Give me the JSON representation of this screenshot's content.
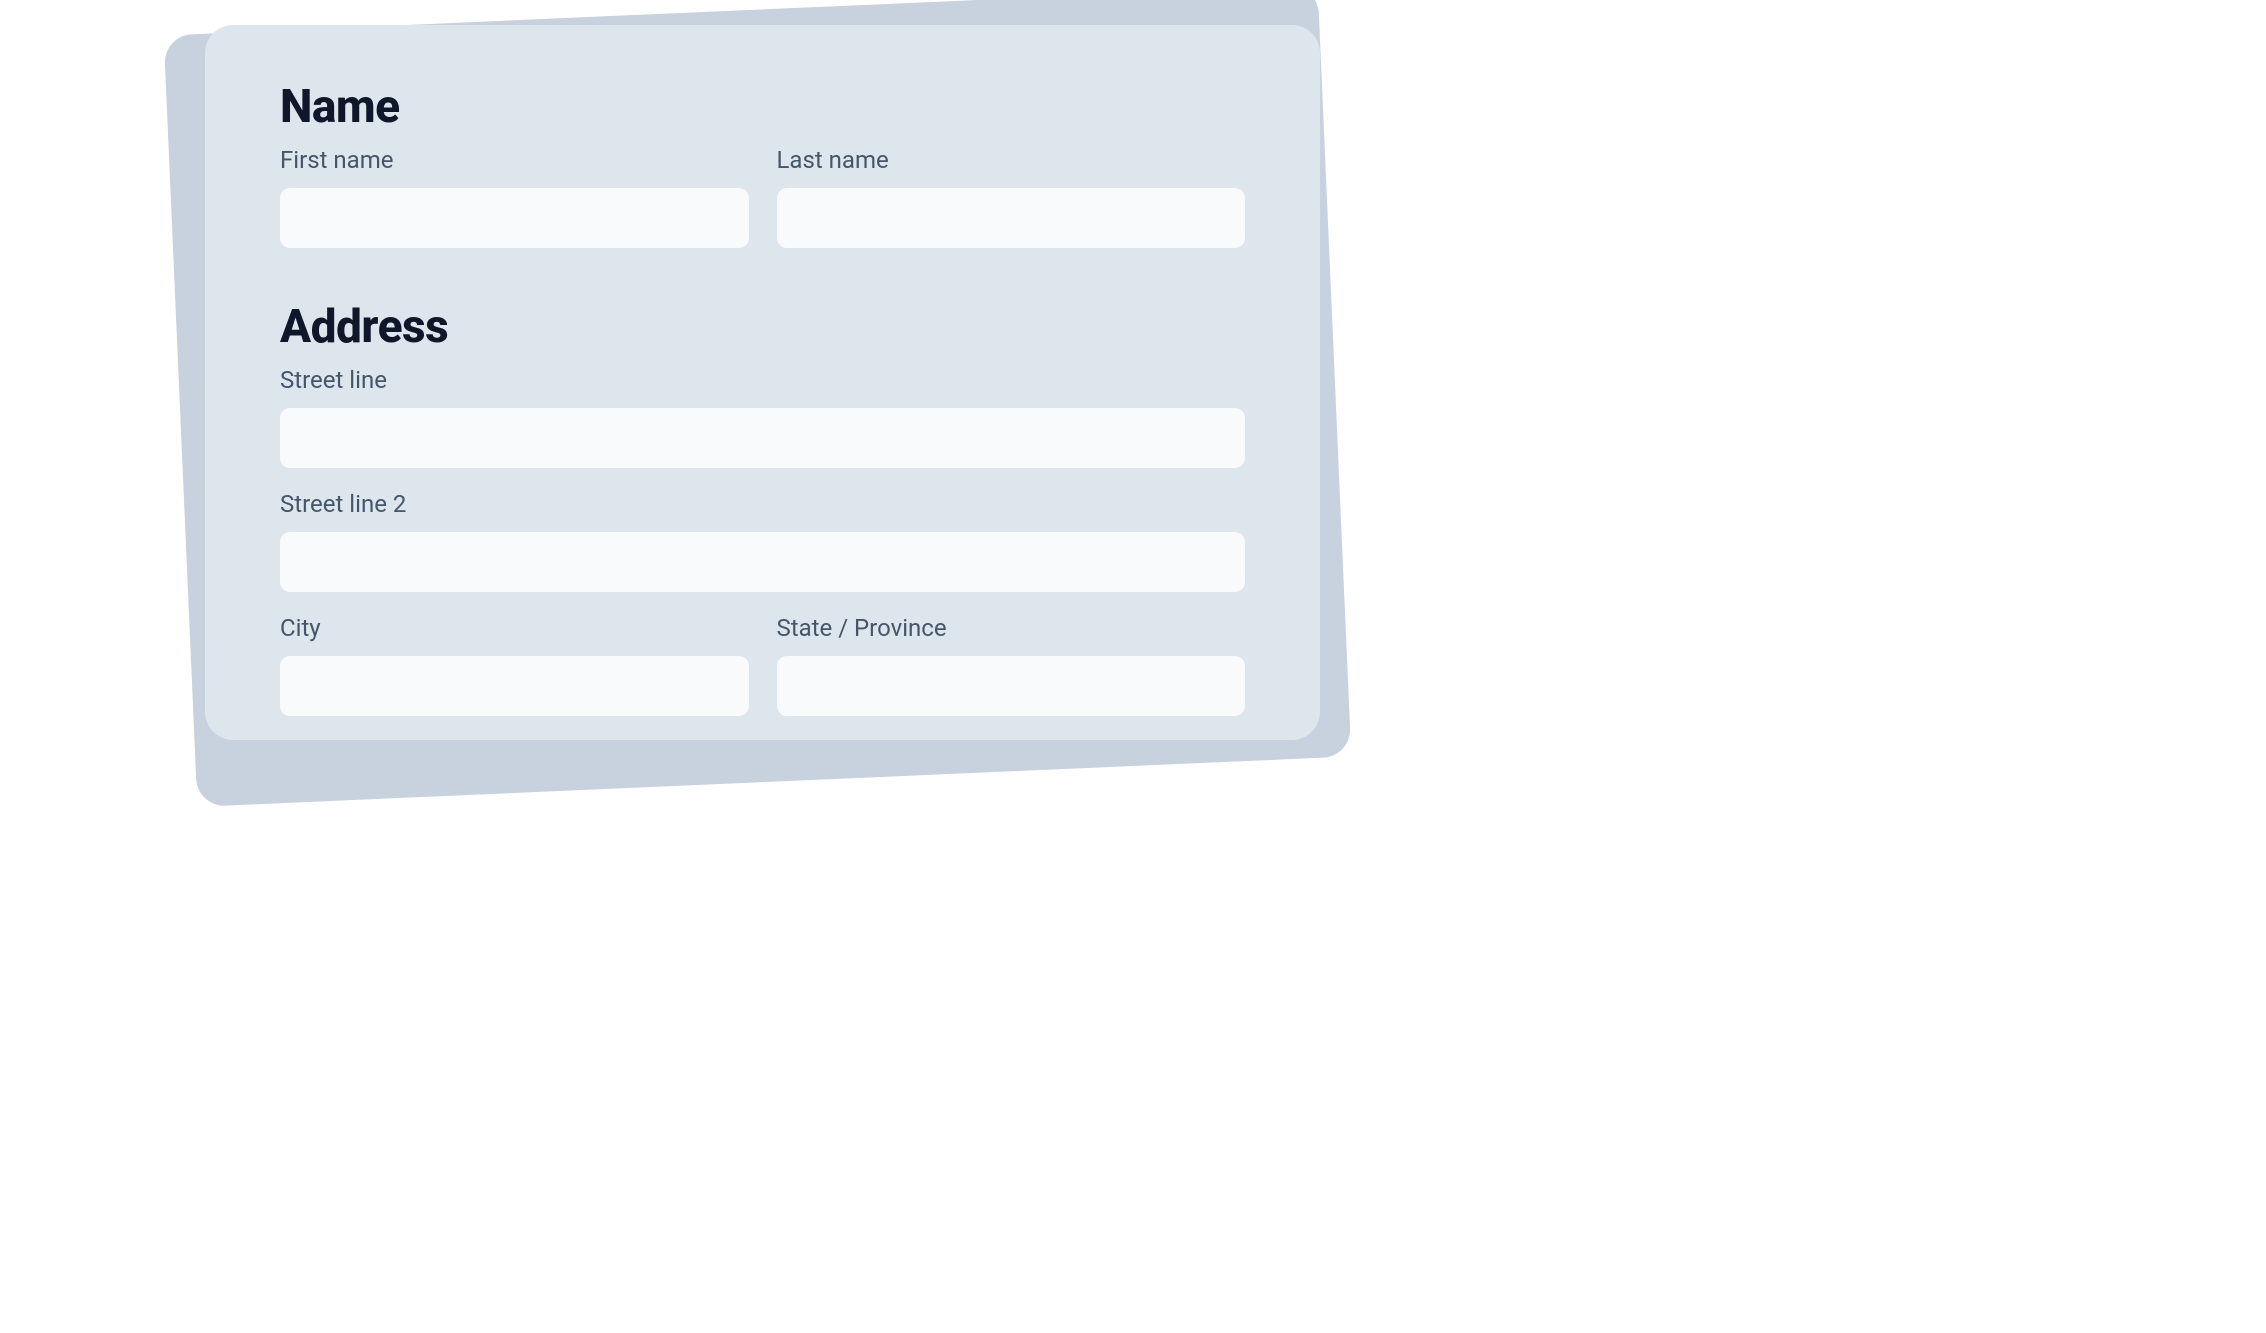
{
  "sections": {
    "name": {
      "title": "Name",
      "fields": {
        "first_name": {
          "label": "First name",
          "value": ""
        },
        "last_name": {
          "label": "Last name",
          "value": ""
        }
      }
    },
    "address": {
      "title": "Address",
      "fields": {
        "street1": {
          "label": "Street line",
          "value": ""
        },
        "street2": {
          "label": "Street line 2",
          "value": ""
        },
        "city": {
          "label": "City",
          "value": ""
        },
        "state": {
          "label": "State / Province",
          "value": ""
        }
      }
    }
  }
}
